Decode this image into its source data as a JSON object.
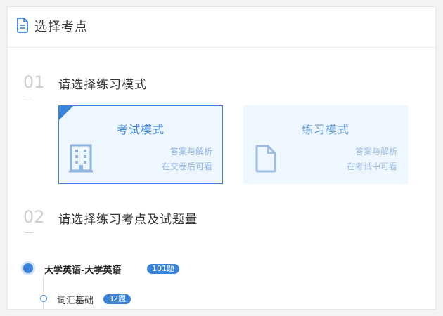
{
  "header": {
    "title": "选择考点",
    "icon": "document-icon"
  },
  "steps": [
    {
      "number": "01",
      "title": "请选择练习模式"
    },
    {
      "number": "02",
      "title": "请选择练习考点及试题量"
    }
  ],
  "modes": {
    "exam": {
      "title": "考试模式",
      "note1": "答案与解析",
      "note2": "在交卷后可看",
      "icon": "building-icon",
      "selected": true
    },
    "practice": {
      "title": "练习模式",
      "note1": "答案与解析",
      "note2": "在考试中可看",
      "icon": "file-icon",
      "selected": false
    }
  },
  "topics": [
    {
      "name": "大学英语-大学英语",
      "count": "101题"
    }
  ],
  "subtopics": [
    {
      "name": "词汇基础",
      "count": "32题"
    }
  ],
  "colors": {
    "accent": "#3a83db",
    "card_bg": "#eef6ff"
  }
}
